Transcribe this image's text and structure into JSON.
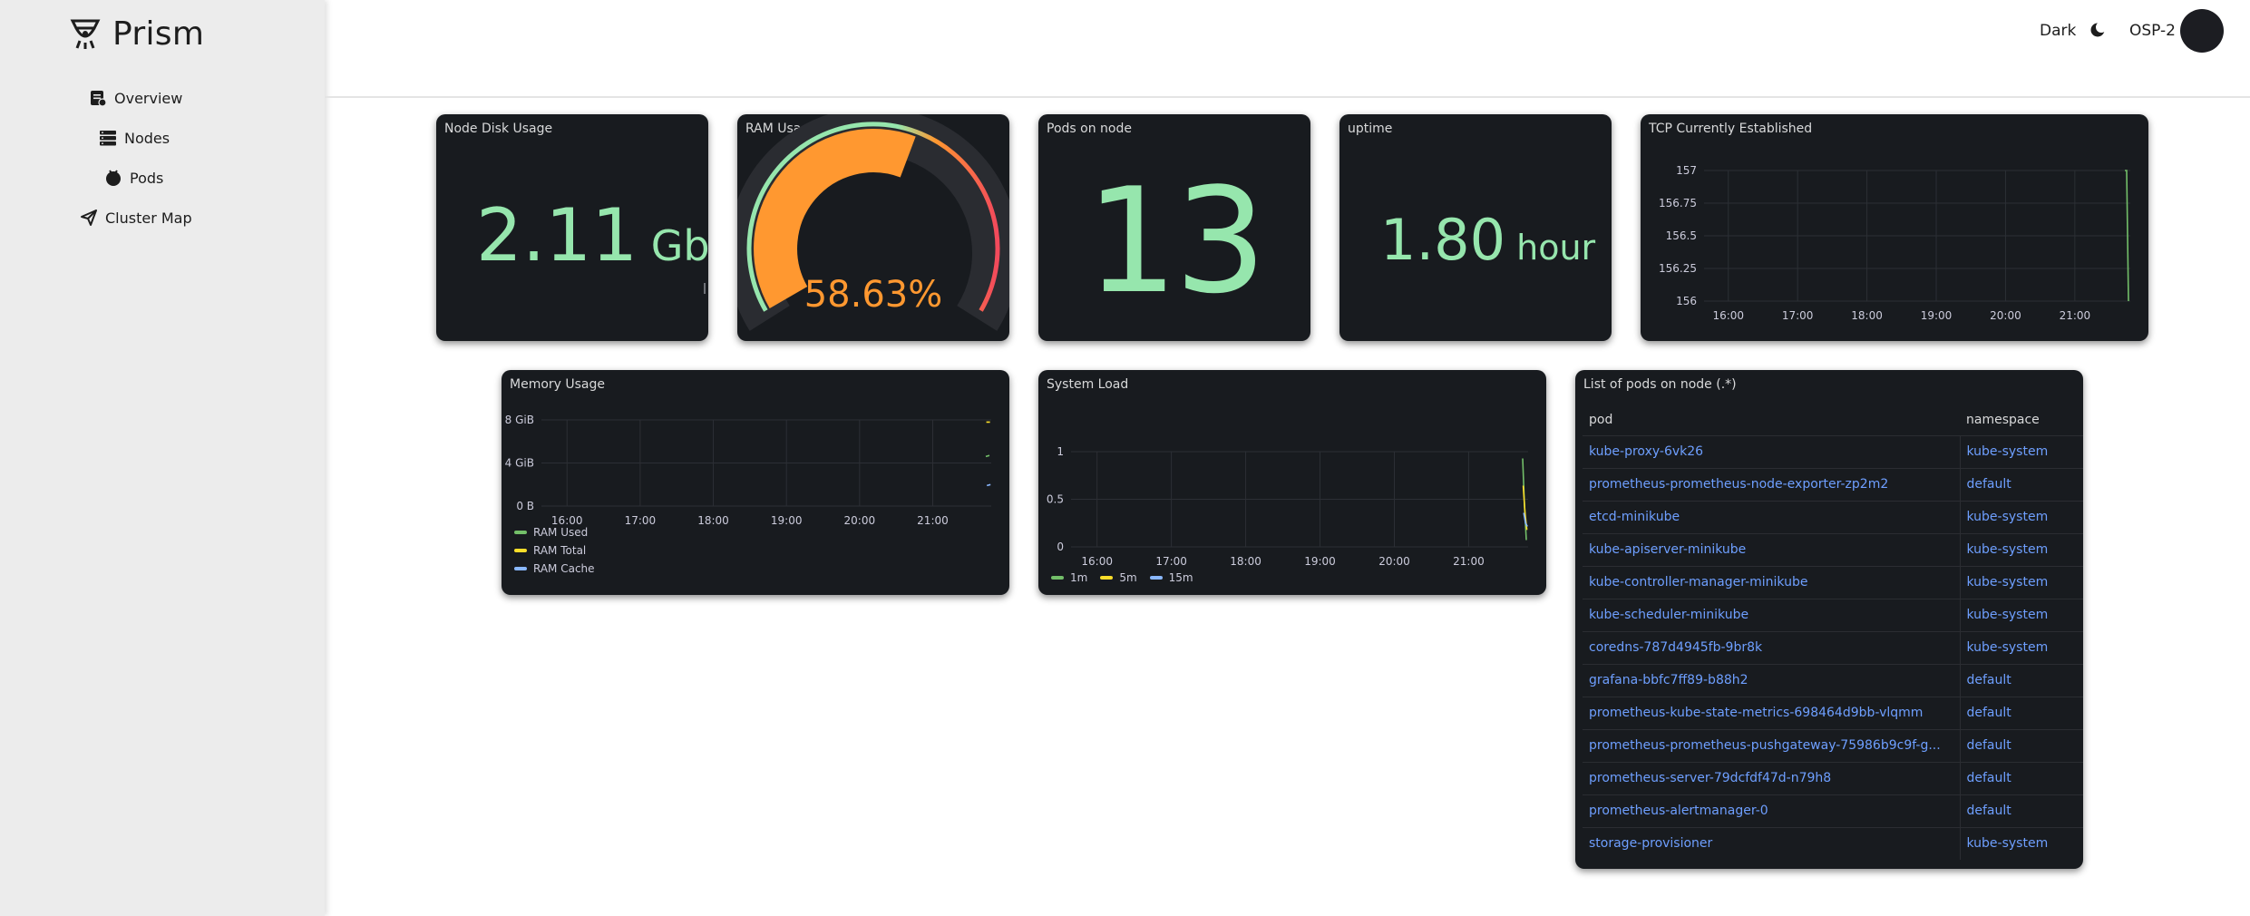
{
  "app": {
    "name": "Prism"
  },
  "nav": [
    {
      "label": "Overview",
      "icon": "overview-icon"
    },
    {
      "label": "Nodes",
      "icon": "nodes-icon"
    },
    {
      "label": "Pods",
      "icon": "pods-icon"
    },
    {
      "label": "Cluster Map",
      "icon": "cluster-map-icon"
    }
  ],
  "topbar": {
    "theme_label": "Dark",
    "theme_icon": "moon-icon",
    "cluster": "OSP-2"
  },
  "panels": {
    "disk": {
      "title": "Node Disk Usage",
      "value": "2.11",
      "unit": "Gb"
    },
    "ram": {
      "title": "RAM Usage",
      "value": "58.63%",
      "fraction": 0.5863
    },
    "pods": {
      "title": "Pods on node",
      "value": "13"
    },
    "uptime": {
      "title": "uptime",
      "value": "1.80",
      "unit": "hour"
    },
    "tcp": {
      "title": "TCP Currently Established"
    },
    "memory": {
      "title": "Memory Usage"
    },
    "load": {
      "title": "System Load"
    },
    "podlist": {
      "title": "List of pods on node (.*)"
    }
  },
  "colors": {
    "accent_green": "#96e6ad",
    "accent_orange": "#ff9830",
    "panel_bg": "#181b1f",
    "link_blue": "#6e9fff",
    "series_green": "#73bf69",
    "series_yellow": "#fade2a",
    "series_blue": "#8ab8ff",
    "series_red": "#f2495c"
  },
  "chart_data": [
    {
      "type": "line",
      "title": "TCP Currently Established",
      "x_ticks": [
        "16:00",
        "17:00",
        "18:00",
        "19:00",
        "20:00",
        "21:00"
      ],
      "y_ticks": [
        "157",
        "156.75",
        "156.5",
        "156.25",
        "156"
      ],
      "ylim": [
        156,
        157
      ],
      "grid": true,
      "series": [
        {
          "color": "#73bf69",
          "x": [
            "21:55",
            "21:56",
            "21:57"
          ],
          "values": [
            157,
            157,
            156
          ]
        }
      ]
    },
    {
      "type": "line",
      "title": "Memory Usage",
      "x_ticks": [
        "16:00",
        "17:00",
        "18:00",
        "19:00",
        "20:00",
        "21:00"
      ],
      "y_ticks": [
        "8 GiB",
        "4 GiB",
        "0 B"
      ],
      "ylim": [
        0,
        8
      ],
      "grid": true,
      "legend": "bottom",
      "series": [
        {
          "name": "RAM Used",
          "color": "#73bf69",
          "values": [
            4.6,
            4.7
          ]
        },
        {
          "name": "RAM Total",
          "color": "#fade2a",
          "values": [
            7.8,
            7.8
          ]
        },
        {
          "name": "RAM Cache",
          "color": "#8ab8ff",
          "values": [
            1.9,
            2.0
          ]
        }
      ]
    },
    {
      "type": "line",
      "title": "System Load",
      "x_ticks": [
        "16:00",
        "17:00",
        "18:00",
        "19:00",
        "20:00",
        "21:00"
      ],
      "y_ticks": [
        "1",
        "0.5",
        "0"
      ],
      "ylim": [
        0,
        1.4
      ],
      "grid": true,
      "legend": "bottom",
      "series": [
        {
          "name": "1m",
          "color": "#73bf69",
          "values": [
            1.3,
            0.6,
            0.1
          ]
        },
        {
          "name": "5m",
          "color": "#fade2a",
          "values": [
            0.9,
            0.5,
            0.25
          ]
        },
        {
          "name": "15m",
          "color": "#8ab8ff",
          "values": [
            0.5,
            0.35,
            0.3
          ]
        }
      ]
    }
  ],
  "pod_table": {
    "headers": [
      "pod",
      "namespace"
    ],
    "rows": [
      [
        "kube-proxy-6vk26",
        "kube-system"
      ],
      [
        "prometheus-prometheus-node-exporter-zp2m2",
        "default"
      ],
      [
        "etcd-minikube",
        "kube-system"
      ],
      [
        "kube-apiserver-minikube",
        "kube-system"
      ],
      [
        "kube-controller-manager-minikube",
        "kube-system"
      ],
      [
        "kube-scheduler-minikube",
        "kube-system"
      ],
      [
        "coredns-787d4945fb-9br8k",
        "kube-system"
      ],
      [
        "grafana-bbfc7ff89-b88h2",
        "default"
      ],
      [
        "prometheus-kube-state-metrics-698464d9bb-vlqmm",
        "default"
      ],
      [
        "prometheus-prometheus-pushgateway-75986b9c9f-g...",
        "default"
      ],
      [
        "prometheus-server-79dcfdf47d-n79h8",
        "default"
      ],
      [
        "prometheus-alertmanager-0",
        "default"
      ],
      [
        "storage-provisioner",
        "kube-system"
      ]
    ]
  }
}
